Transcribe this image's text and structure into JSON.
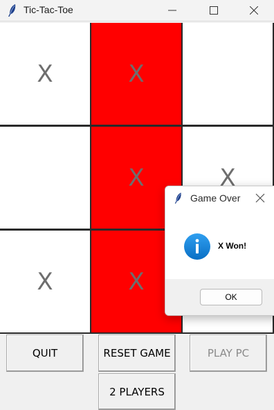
{
  "window": {
    "title": "Tic-Tac-Toe",
    "icon": "feather-icon",
    "controls": [
      "minimize-icon",
      "maximize-icon",
      "close-icon"
    ]
  },
  "board": {
    "cells": [
      "X",
      "X",
      "",
      "",
      "X",
      "X",
      "X",
      "X",
      ""
    ],
    "winning_cells": [
      1,
      4,
      7
    ],
    "win_color": "#ff0000",
    "cell_color": "#ffffff",
    "mark_color": "#6e6e6e"
  },
  "buttons": {
    "quit": "QUIT",
    "reset": "RESET GAME",
    "play_pc": "PLAY PC",
    "two_players": "2 PLAYERS"
  },
  "dialog": {
    "title": "Game Over",
    "icon": "info-icon",
    "message": "X Won!",
    "ok": "OK",
    "accent": "#1a86d9"
  }
}
